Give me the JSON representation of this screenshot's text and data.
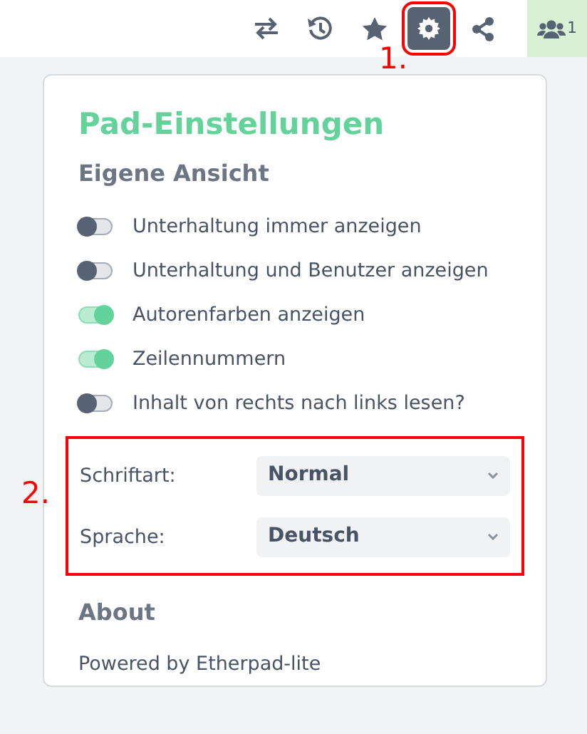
{
  "toolbar": {
    "buttons": [
      {
        "kind": "swap",
        "selected": false
      },
      {
        "kind": "history",
        "selected": false
      },
      {
        "kind": "star",
        "selected": false
      },
      {
        "kind": "settings",
        "selected": true
      },
      {
        "kind": "share",
        "selected": false
      }
    ],
    "users": {
      "count": "1"
    }
  },
  "annotations": [
    {
      "label": "1."
    },
    {
      "label": "2."
    }
  ],
  "settings": {
    "title": "Pad-Einstellungen",
    "section": "Eigene Ansicht",
    "toggles": [
      {
        "label": "Unterhaltung immer anzeigen",
        "on": false
      },
      {
        "label": "Unterhaltung und Benutzer anzeigen",
        "on": false
      },
      {
        "label": "Autorenfarben anzeigen",
        "on": true
      },
      {
        "label": "Zeilennummern",
        "on": true
      },
      {
        "label": "Inhalt von rechts nach links lesen?",
        "on": false
      }
    ],
    "selects": [
      {
        "label": "Schriftart:",
        "value": "Normal"
      },
      {
        "label": "Sprache:",
        "value": "Deutsch"
      }
    ],
    "about": {
      "title": "About",
      "text": "Powered by Etherpad-lite"
    }
  }
}
